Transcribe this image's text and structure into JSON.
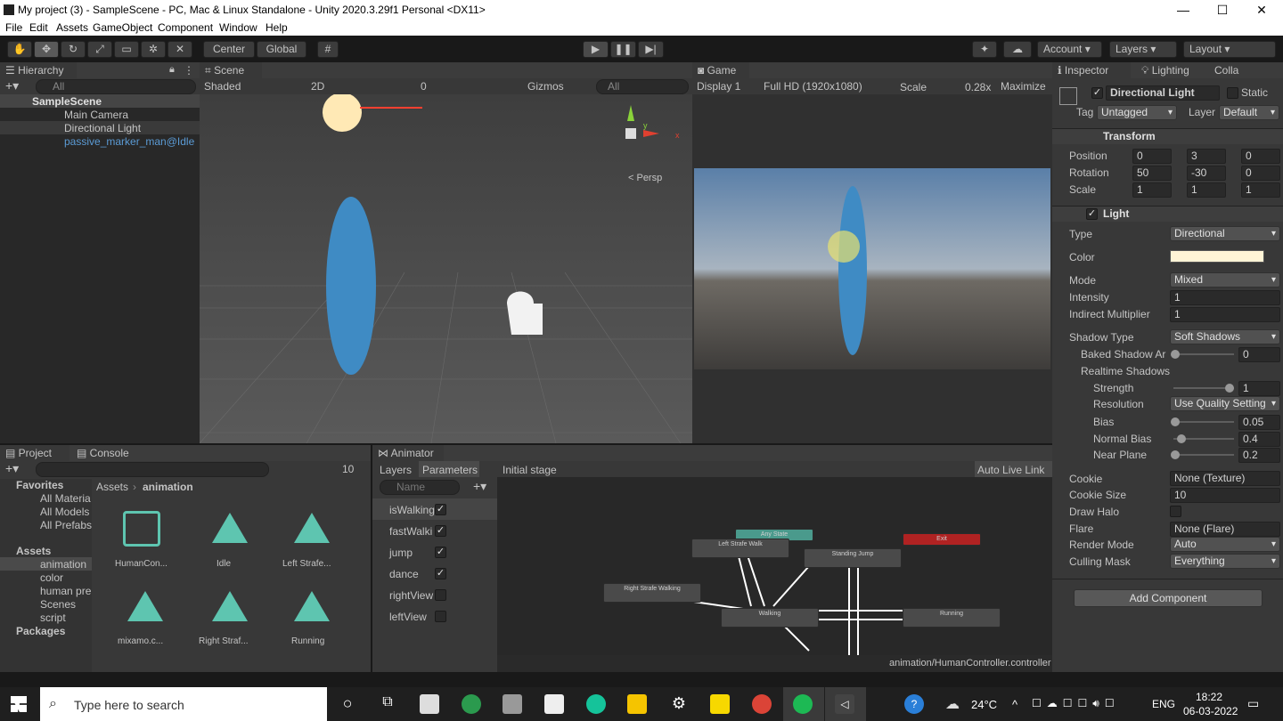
{
  "window": {
    "title": "My project (3) - SampleScene - PC, Mac & Linux Standalone - Unity 2020.3.29f1 Personal <DX11>"
  },
  "menu": [
    "File",
    "Edit",
    "Assets",
    "GameObject",
    "Component",
    "Window",
    "Help"
  ],
  "toolbar": {
    "center": "Center",
    "global": "Global",
    "account": "Account",
    "layers": "Layers",
    "layout": "Layout"
  },
  "hierarchy": {
    "tab": "Hierarchy",
    "search": "All",
    "scene": "SampleScene",
    "items": [
      "Main Camera",
      "Directional Light",
      "passive_marker_man@Idle"
    ]
  },
  "scene": {
    "tab": "Scene",
    "shading": "Shaded",
    "mode2d": "2D",
    "hidden_count": "0",
    "gizmos": "Gizmos",
    "search": "All",
    "persp": "< Persp",
    "axis_x": "x",
    "axis_y": "y"
  },
  "game": {
    "tab": "Game",
    "display": "Display 1",
    "resolution": "Full HD (1920x1080)",
    "scale_label": "Scale",
    "scale_value": "0.28x",
    "maximize": "Maximize"
  },
  "inspector": {
    "tabs": [
      "Inspector",
      "Lighting",
      "Colla"
    ],
    "object_name": "Directional Light",
    "static": "Static",
    "tag_label": "Tag",
    "tag": "Untagged",
    "layer_label": "Layer",
    "layer": "Default",
    "transform": {
      "title": "Transform",
      "position": {
        "label": "Position",
        "x": "0",
        "y": "3",
        "z": "0"
      },
      "rotation": {
        "label": "Rotation",
        "x": "50",
        "y": "-30",
        "z": "0"
      },
      "scale": {
        "label": "Scale",
        "x": "1",
        "y": "1",
        "z": "1"
      }
    },
    "light": {
      "title": "Light",
      "type_label": "Type",
      "type": "Directional",
      "color_label": "Color",
      "color": "#fff4d6",
      "mode_label": "Mode",
      "mode": "Mixed",
      "intensity_label": "Intensity",
      "intensity": "1",
      "indirect_label": "Indirect Multiplier",
      "indirect": "1",
      "shadow_type_label": "Shadow Type",
      "shadow_type": "Soft Shadows",
      "baked_label": "Baked Shadow Ar",
      "baked": "0",
      "realtime_label": "Realtime Shadows",
      "strength_label": "Strength",
      "strength": "1",
      "resolution_label": "Resolution",
      "resolution": "Use Quality Setting",
      "bias_label": "Bias",
      "bias": "0.05",
      "normal_bias_label": "Normal Bias",
      "normal_bias": "0.4",
      "near_plane_label": "Near Plane",
      "near_plane": "0.2",
      "cookie_label": "Cookie",
      "cookie": "None (Texture)",
      "cookie_size_label": "Cookie Size",
      "cookie_size": "10",
      "draw_halo_label": "Draw Halo",
      "flare_label": "Flare",
      "flare": "None (Flare)",
      "render_mode_label": "Render Mode",
      "render_mode": "Auto",
      "culling_label": "Culling Mask",
      "culling": "Everything"
    },
    "add_component": "Add Component"
  },
  "project": {
    "tabs": [
      "Project",
      "Console"
    ],
    "hidden_count": "10",
    "favorites": "Favorites",
    "fav_items": [
      "All Materia",
      "All Models",
      "All Prefabs"
    ],
    "assets": "Assets",
    "asset_folders": [
      "animation",
      "color",
      "human pre",
      "Scenes",
      "script"
    ],
    "packages": "Packages",
    "breadcrumb_root": "Assets",
    "breadcrumb_leaf": "animation",
    "files": [
      "HumanCon...",
      "Idle",
      "Left Strafe...",
      "mixamo.c...",
      "Right Straf...",
      "Running"
    ]
  },
  "animator": {
    "tab": "Animator",
    "layers_tab": "Layers",
    "params_tab": "Parameters",
    "stage": "Initial stage",
    "live_link": "Auto Live Link",
    "name_placeholder": "Name",
    "params": [
      {
        "name": "isWalking",
        "checked": true
      },
      {
        "name": "fastWalki",
        "checked": true
      },
      {
        "name": "jump",
        "checked": true
      },
      {
        "name": "dance",
        "checked": true
      },
      {
        "name": "rightView",
        "checked": false
      },
      {
        "name": "leftView",
        "checked": false
      }
    ],
    "states": {
      "any": "Any State",
      "exit": "Exit",
      "left_strafe": "Left Strafe Walk",
      "standing_jump": "Standing Jump",
      "right_strafe": "Right Strafe Walking",
      "walking": "Walking",
      "running": "Running"
    },
    "path": "animation/HumanController.controller"
  },
  "taskbar": {
    "search": "Type here to search",
    "temp": "24°C",
    "lang": "ENG",
    "time": "18:22",
    "date": "06-03-2022"
  }
}
